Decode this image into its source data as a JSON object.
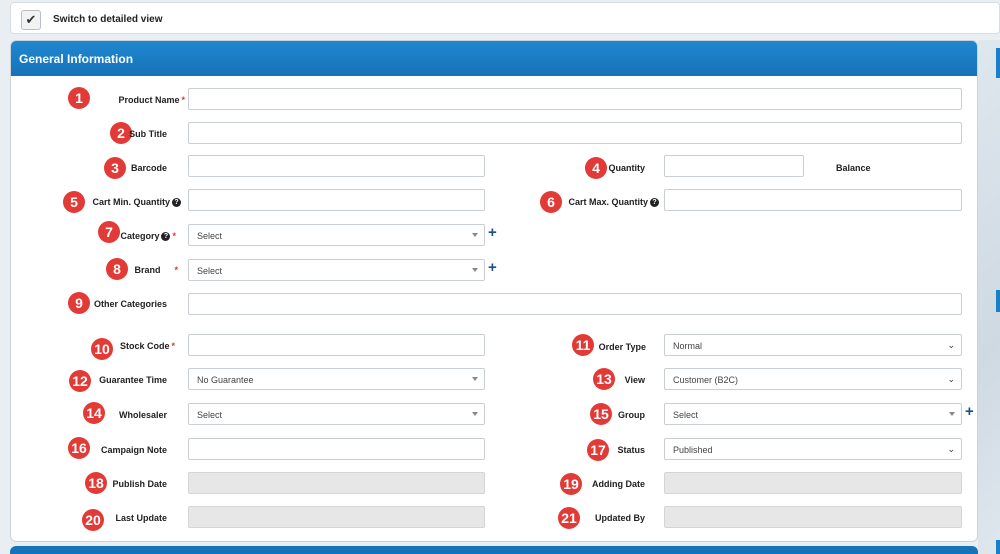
{
  "switch": {
    "label": "Switch to detailed view",
    "checked_glyph": "✔"
  },
  "panel": {
    "title": "General Information"
  },
  "badges": [
    "1",
    "2",
    "3",
    "4",
    "5",
    "6",
    "7",
    "8",
    "9",
    "10",
    "11",
    "12",
    "13",
    "14",
    "15",
    "16",
    "17",
    "18",
    "19",
    "20",
    "21"
  ],
  "labels": {
    "product_name": "Product Name",
    "sub_title": "Sub Title",
    "barcode": "Barcode",
    "quantity": "Quantity",
    "balance": "Balance",
    "cart_min": "Cart Min. Quantity",
    "cart_max": "Cart Max. Quantity",
    "category": "Category",
    "brand": "Brand",
    "other_categories": "Other Categories",
    "stock_code": "Stock Code",
    "order_type": "Order Type",
    "guarantee_time": "Guarantee Time",
    "view": "View",
    "wholesaler": "Wholesaler",
    "group": "Group",
    "campaign_note": "Campaign Note",
    "status": "Status",
    "publish_date": "Publish Date",
    "adding_date": "Adding Date",
    "last_update": "Last Update",
    "updated_by": "Updated By"
  },
  "required_mark": "*",
  "help_glyph": "?",
  "plus_glyph": "+",
  "chevron_glyph": "⌄",
  "values": {
    "category": "Select",
    "brand": "Select",
    "order_type": "Normal",
    "guarantee_time": "No Guarantee",
    "view": "Customer (B2C)",
    "wholesaler": "Select",
    "group": "Select",
    "status": "Published"
  }
}
